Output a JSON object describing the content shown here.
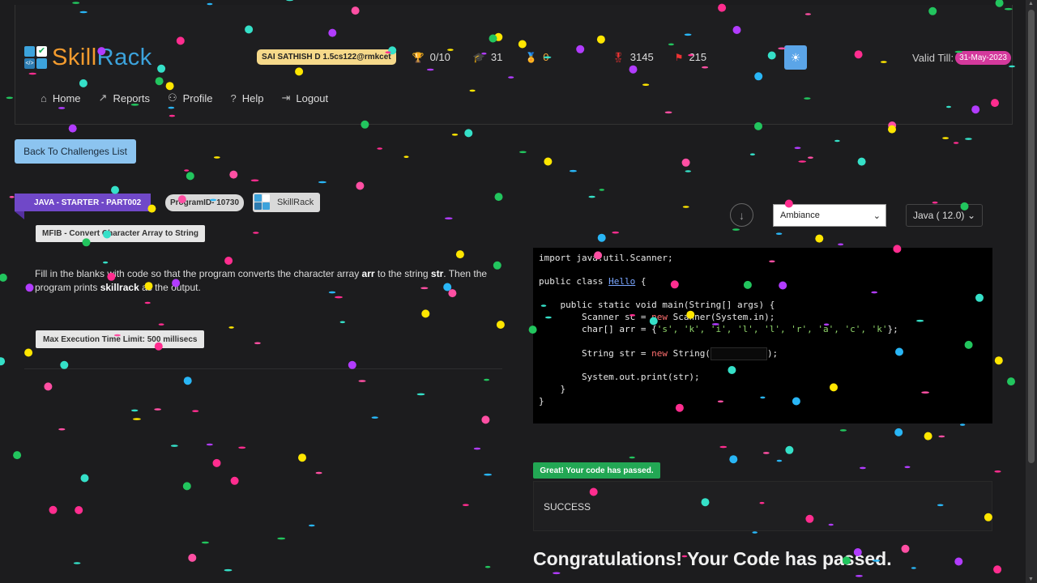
{
  "header": {
    "logo_part1": "Skill",
    "logo_part2": "Rack",
    "user": "SAI SATHISH D 1.5cs122@rmkcet",
    "stats": [
      {
        "icon": "trophy-icon",
        "glyph": "🏆",
        "value": "0/10"
      },
      {
        "icon": "graduation-cap-icon",
        "glyph": "🎓",
        "value": "31"
      },
      {
        "icon": "medal-icon",
        "glyph": "🏅",
        "value": "0"
      },
      {
        "icon": "badge-icon",
        "glyph": "🎖",
        "value": "3145"
      },
      {
        "icon": "flag-icon",
        "glyph": "⚑",
        "value": "215"
      }
    ],
    "valid_label": "Valid Till:",
    "valid_date": "31-May-2023"
  },
  "nav": [
    {
      "label": "Home",
      "icon": "home-icon",
      "glyph": "⌂"
    },
    {
      "label": "Reports",
      "icon": "chart-icon",
      "glyph": "📈"
    },
    {
      "label": "Profile",
      "icon": "user-icon",
      "glyph": "👤"
    },
    {
      "label": "Help",
      "icon": "help-icon",
      "glyph": "?"
    },
    {
      "label": "Logout",
      "icon": "logout-icon",
      "glyph": "⇥"
    }
  ],
  "back_button": "Back To Challenges List",
  "tags": {
    "course": "JAVA - STARTER - PART002",
    "program_id": "ProgramID- 10730",
    "source": "SkillRack"
  },
  "problem": {
    "title": "MFIB - Convert Character Array to String",
    "desc_part1": "Fill in the blanks with code so that the program converts the character array ",
    "desc_arr": "arr",
    "desc_part2": " to the string ",
    "desc_str": "str",
    "desc_part3": ". Then the program prints ",
    "desc_out": "skillrack",
    "desc_part4": " as the output.",
    "limit": "Max Execution Time Limit: 500 millisecs"
  },
  "editor_controls": {
    "theme": "Ambiance",
    "language": "Java ( 12.0)"
  },
  "code": {
    "l1_kw": "import",
    "l1_rest": " java.util.Scanner;",
    "l2_kw": "public class",
    "l2_name": "Hello",
    "l2_rest": " {",
    "l3_kw": "public static void",
    "l3_rest": " main(String[] args) {",
    "l4_a": "Scanner sc = ",
    "l4_new": "new",
    "l4_b": " Scanner(System.in);",
    "l5_a": "char[] arr = {",
    "l5_chars": "'s', 'k', 'i', 'l', 'l', 'r', 'a', 'c', 'k'",
    "l5_b": "};",
    "l6_a": "String str = ",
    "l6_new": "new",
    "l6_b": " String(",
    "l6_c": ");",
    "l7": "System.out.print(str);",
    "l8": "}",
    "l9": "}"
  },
  "result": {
    "passed_badge": "Great! Your code has passed.",
    "output": "SUCCESS",
    "congrats": "Congratulations! Your Code has passed."
  },
  "colors": {
    "accent_blue": "#3ca3dc",
    "accent_orange": "#f39b2e",
    "success_green": "#22a754",
    "tag_purple": "#7048c8"
  }
}
